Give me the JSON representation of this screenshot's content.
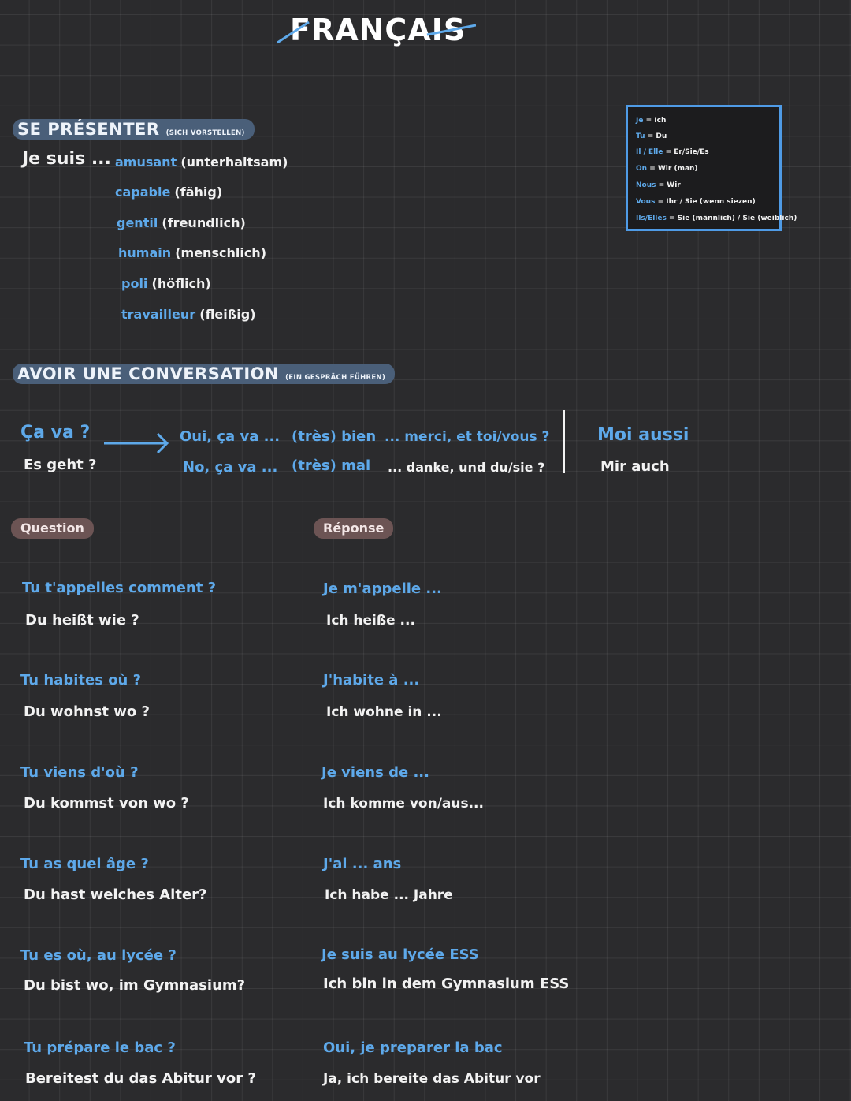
{
  "title": "FRANÇAIS",
  "section1": {
    "heading": "SE PRÉSENTER",
    "heading_note": "(SICH VORSTELLEN)",
    "lead": "Je suis ...",
    "adjectives": [
      {
        "fr": "amusant",
        "de": "(unterhaltsam)"
      },
      {
        "fr": "capable",
        "de": "(fähig)"
      },
      {
        "fr": "gentil",
        "de": "(freundlich)"
      },
      {
        "fr": "humain",
        "de": "(menschlich)"
      },
      {
        "fr": "poli",
        "de": "(höflich)"
      },
      {
        "fr": "travailleur",
        "de": "(fleißig)"
      }
    ]
  },
  "legend": {
    "rows": [
      {
        "k": "Je",
        "v": "= Ich"
      },
      {
        "k": "Tu",
        "v": "= Du"
      },
      {
        "k": "Il / Elle",
        "v": "= Er/Sie/Es"
      },
      {
        "k": "On",
        "v": "= Wir (man)"
      },
      {
        "k": "Nous",
        "v": "= Wir"
      },
      {
        "k": "Vous",
        "v": "= Ihr / Sie (wenn siezen)"
      },
      {
        "k": "Ils/Elles",
        "v": "= Sie (männlich) / Sie (weiblich)"
      }
    ]
  },
  "section2": {
    "heading": "AVOIR UNE CONVERSATION",
    "heading_note": "(EIN GESPRÄCH FÜHREN)",
    "q_fr": "Ça va ?",
    "q_de": "Es geht ?",
    "ans1_a": "Oui, ça va ...",
    "ans1_b": "(très) bien",
    "ans1_c": "... merci, et toi/vous ?",
    "ans2_a": "No, ça va ...",
    "ans2_b": "(très) mal",
    "ans2_c": "... danke, und du/sie ?",
    "reply_fr": "Moi aussi",
    "reply_de": "Mir auch"
  },
  "qa": {
    "question_tag": "Question",
    "answer_tag": "Réponse",
    "pairs": [
      {
        "q_fr": "Tu t'appelles comment ?",
        "q_de": "Du heißt wie ?",
        "a_fr": "Je m'appelle ...",
        "a_de": "Ich heiße ..."
      },
      {
        "q_fr": "Tu habites où ?",
        "q_de": "Du wohnst wo ?",
        "a_fr": "J'habite à ...",
        "a_de": "Ich wohne in ..."
      },
      {
        "q_fr": "Tu viens d'où ?",
        "q_de": "Du kommst von wo ?",
        "a_fr": "Je viens de ...",
        "a_de": "Ich komme von/aus..."
      },
      {
        "q_fr": "Tu as quel âge ?",
        "q_de": "Du hast welches Alter?",
        "a_fr": "J'ai ... ans",
        "a_de": "Ich habe ... Jahre"
      },
      {
        "q_fr": "Tu es où, au lycée ?",
        "q_de": "Du bist wo, im Gymnasium?",
        "a_fr": "Je suis au lycée ESS",
        "a_de": "Ich bin in dem Gymnasium ESS"
      },
      {
        "q_fr": "Tu prépare le bac ?",
        "q_de": "Bereitest du das Abitur vor ?",
        "a_fr": "Oui, je preparer la bac",
        "a_de": "Ja, ich bereite das Abitur vor"
      }
    ]
  },
  "colors": {
    "accent": "#5ea9ea",
    "background": "#2b2b2d",
    "pill": "#4a5f79",
    "tag": "#6c5454"
  }
}
